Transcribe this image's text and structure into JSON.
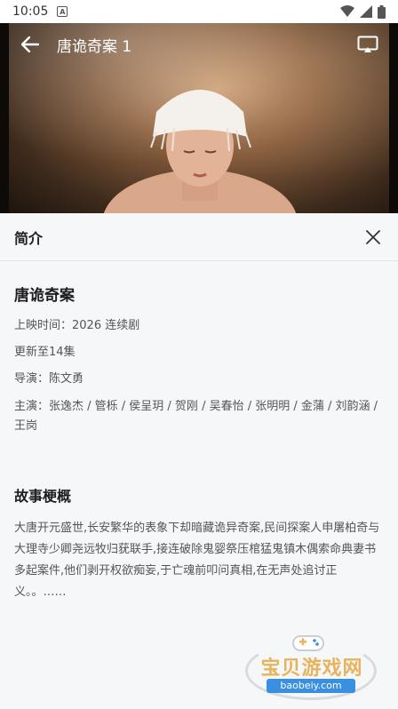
{
  "status_bar": {
    "time": "10:05",
    "notification_letter": "A"
  },
  "video": {
    "title": "唐诡奇案 1"
  },
  "panel": {
    "title": "简介"
  },
  "show": {
    "title": "唐诡奇案",
    "release": "上映时间：2026  连续剧",
    "update": "更新至14集",
    "director": "导演：陈文勇",
    "cast": "主演：张逸杰 / 管栎 / 侯呈玥 / 贺刚 / 吴春怡 / 张明明 / 金蒲 / 刘韵涵 / 王岗"
  },
  "synopsis": {
    "title": "故事梗概",
    "text": "大唐开元盛世,长安繁华的表象下却暗藏诡异奇案,民间探案人申屠柏奇与大理寺少卿尧远牧归莸联手,接连破除鬼婴祭压棺猛鬼镇木偶索命典妻书多起案件,他们剥开权欲痴妄,于亡魂前叩问真相,在无声处追讨正义。。……"
  },
  "watermark": {
    "name": "宝贝游戏网",
    "url": "baobeiy.com"
  }
}
